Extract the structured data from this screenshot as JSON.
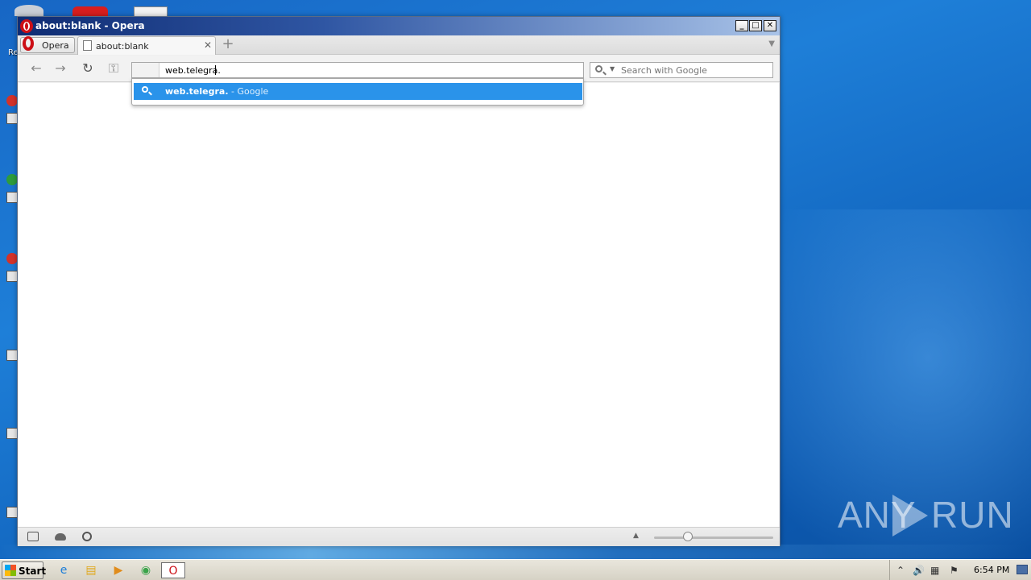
{
  "window": {
    "title": "about:blank - Opera",
    "minimize": "_",
    "maximize": "□",
    "close": "✕"
  },
  "tabstrip": {
    "menu_label": "Opera",
    "tabs": [
      {
        "label": "about:blank",
        "close": "✕"
      }
    ],
    "new_tab": "+",
    "tab_menu": "▼"
  },
  "toolbar": {
    "back": "←",
    "forward": "→",
    "reload": "↻",
    "key": "⚿",
    "address_value": "web.telegra.",
    "search_placeholder": "Search with Google",
    "search_dropdown": "▼"
  },
  "suggestions": [
    {
      "query": "web.telegra.",
      "engine": " - Google"
    }
  ],
  "statusbar": {
    "up_arrow": "▲"
  },
  "watermark": {
    "left": "ANY",
    "right": "RUN"
  },
  "taskbar": {
    "start_label": "Start",
    "apps": [
      "ie-icon",
      "explorer-icon",
      "media-player-icon",
      "chrome-icon",
      "opera-icon"
    ],
    "tray_time": "6:54 PM"
  },
  "colors": {
    "suggestion_highlight": "#2a93ea",
    "titlebar_start": "#0f2c73",
    "opera_red": "#cc0f16"
  }
}
